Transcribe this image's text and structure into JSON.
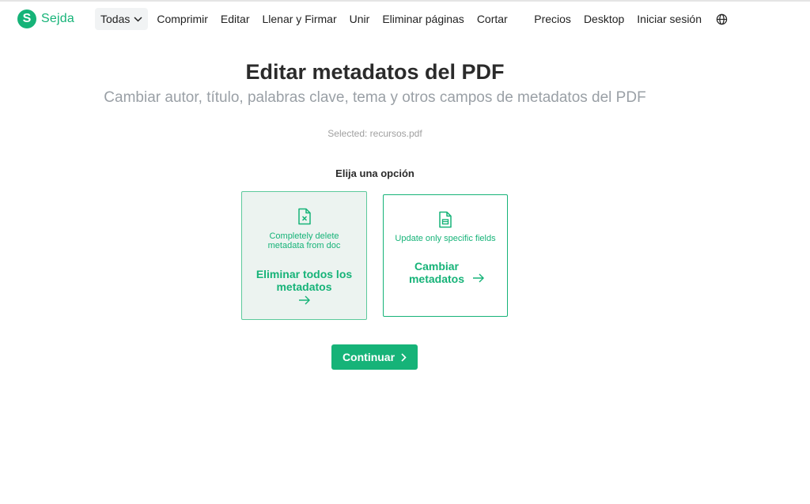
{
  "brand": {
    "name": "Sejda",
    "mark": "S",
    "color": "#16b378"
  },
  "nav": {
    "all_label": "Todas",
    "items": [
      "Comprimir",
      "Editar",
      "Llenar y Firmar",
      "Unir",
      "Eliminar páginas",
      "Cortar"
    ],
    "right_items": [
      "Precios",
      "Desktop",
      "Iniciar sesión"
    ]
  },
  "page": {
    "title": "Editar metadatos del PDF",
    "subtitle": "Cambiar autor, título, palabras clave, tema y otros campos de metadatos del PDF",
    "selected": "Selected: recursos.pdf",
    "choose_label": "Elija una opción"
  },
  "options": [
    {
      "icon": "file-x-icon",
      "description": "Completely delete metadata from doc",
      "action_label": "Eliminar todos los metadatos",
      "selected": true
    },
    {
      "icon": "file-edit-icon",
      "description": "Update only specific fields",
      "action_label": "Cambiar metadatos",
      "selected": false
    }
  ],
  "continue_label": "Continuar"
}
